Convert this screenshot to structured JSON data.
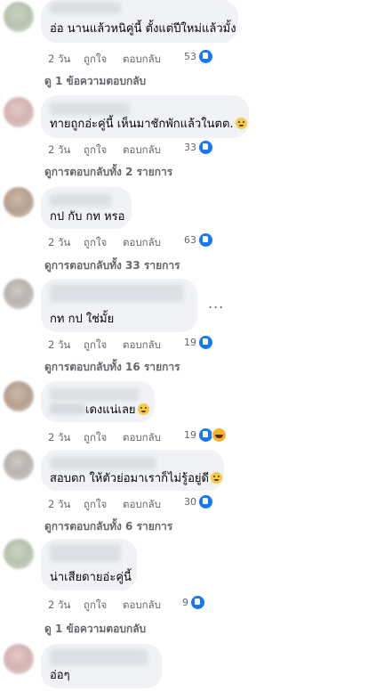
{
  "comments": [
    {
      "text": "อ่อ นานแล้วหนิคู่นี้ ตั้งแต่ปีใหม่แล้วมั้ง",
      "time": "2 วัน",
      "like": "ถูกใจ",
      "reply": "ตอบกลับ",
      "reactions": "53",
      "view_replies": "ดู 1 ข้อความตอบกลับ"
    },
    {
      "text": "ทายถูกอ่ะคู่นี้ เห็นมาชักพักแล้วในตต.",
      "time": "2 วัน",
      "like": "ถูกใจ",
      "reply": "ตอบกลับ",
      "reactions": "33",
      "view_replies": "ดูการตอบกลับทั้ง 2 รายการ"
    },
    {
      "text": "กป กับ กท หรอ",
      "time": "2 วัน",
      "like": "ถูกใจ",
      "reply": "ตอบกลับ",
      "reactions": "63",
      "view_replies": "ดูการตอบกลับทั้ง 33 รายการ"
    },
    {
      "text": "กท กป ใช่มั้ย",
      "time": "2 วัน",
      "like": "ถูกใจ",
      "reply": "ตอบกลับ",
      "reactions": "19",
      "view_replies": "ดูการตอบกลับทั้ง 16 รายการ",
      "more": "..."
    },
    {
      "text": "เดงแน่เลย",
      "time": "2 วัน",
      "like": "ถูกใจ",
      "reply": "ตอบกลับ",
      "reactions": "19"
    },
    {
      "text": "สอบตก ให้ตัวย่อมาเราก็ไม่รู้อยู่ดี",
      "time": "2 วัน",
      "like": "ถูกใจ",
      "reply": "ตอบกลับ",
      "reactions": "30",
      "view_replies": "ดูการตอบกลับทั้ง 6 รายการ"
    },
    {
      "text": "น่าเสียดายอ่ะคู่นี้",
      "time": "2 วัน",
      "like": "ถูกใจ",
      "reply": "ตอบกลับ",
      "reactions": "9",
      "view_replies": "ดู 1 ข้อความตอบกลับ"
    },
    {
      "text": "อ่อๆ"
    }
  ],
  "icons": {
    "like": "like-reaction-icon",
    "haha": "haha-reaction-icon",
    "emoji": "grimace-emoji-icon"
  },
  "colors": {
    "bubble": "#f0f2f5",
    "meta": "#65676b",
    "like_blue": "#1877f2"
  }
}
